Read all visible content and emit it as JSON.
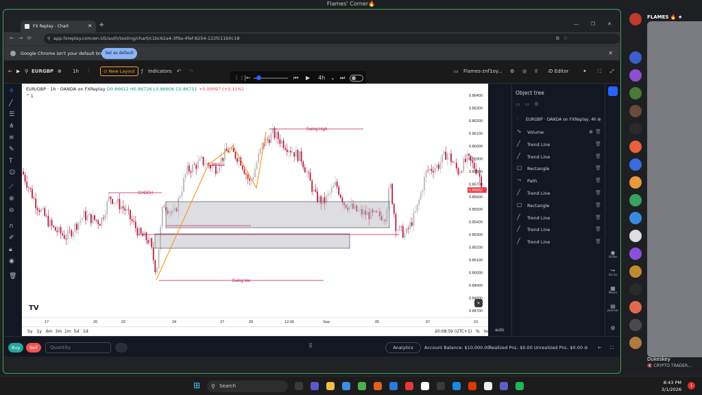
{
  "window_title": "Flames' Corner🔥",
  "chrome": {
    "tab_title": "FX Replay - Chart",
    "url": "app.fxreplay.com/en-US/auth/testing/chart/c1bc62a4-3f9a-4fef-8254-122fc11b0c18",
    "infobar_message": "Google Chrome isn't your default browser",
    "set_default_label": "Set as default"
  },
  "toolbar": {
    "symbol": "EURGBP",
    "timeframe": "1h",
    "new_layout": "New Layout",
    "indicators": "Indicators",
    "replay_timeframe": "4h",
    "layout_name": "Flames-znf1oy...",
    "editor": "Editor"
  },
  "chart": {
    "symbol_line": "EUR/GBP · 1h · OANDA on FXReplay",
    "ohlc": "O0.86612 H0.86726 L0.86606 C0.86711",
    "change": "+0.00097 (+0.11%)",
    "collapse": "^ 1",
    "current_price": "0.85652",
    "y_ticks": [
      "0.86400",
      "0.86300",
      "0.86200",
      "0.86100",
      "0.86000",
      "0.85900",
      "0.85800",
      "0.85700",
      "0.85600",
      "0.85500",
      "0.85400",
      "0.85300",
      "0.85200",
      "0.85100",
      "0.85000",
      "0.84900",
      "0.84800",
      "0.84700"
    ],
    "x_ticks": [
      "17",
      "20",
      "22",
      "24",
      "27",
      "29",
      "12:00",
      "Sep",
      "05",
      "07",
      "10"
    ],
    "annotations": {
      "choch": "CHOCH",
      "swing_high": "Swing High",
      "swing_low": "Swing low",
      "bos": "BOS"
    },
    "logo": "TV"
  },
  "bottom_bar": {
    "ranges": [
      "5y",
      "1y",
      "6m",
      "3m",
      "1m",
      "5d",
      "1d"
    ],
    "time": "20:08:59 (UTC+1)",
    "pct": "%",
    "log": "log",
    "auto": "auto"
  },
  "trade_bar": {
    "buy": "Buy",
    "sell": "Sell",
    "qty_placeholder": "Quantity",
    "analytics": "Analytics",
    "account_balance": "Account Balance: $10,000.00",
    "realized_pnl": "Realized PnL: $0.00",
    "unrealized_pnl": "Unrealized PnL: $0.00"
  },
  "object_tree": {
    "title": "Object tree",
    "source": "EURGBP · OANDA on FXReplay, 4h",
    "items": [
      {
        "label": "Volume",
        "icon": "volume-icon"
      },
      {
        "label": "Trend Line",
        "icon": "trend-line-icon"
      },
      {
        "label": "Trend Line",
        "icon": "trend-line-icon"
      },
      {
        "label": "Rectangle",
        "icon": "rectangle-icon"
      },
      {
        "label": "Path",
        "icon": "path-icon"
      },
      {
        "label": "Trend Line",
        "icon": "trend-line-icon"
      },
      {
        "label": "Rectangle",
        "icon": "rectangle-icon"
      },
      {
        "label": "Trend Line",
        "icon": "trend-line-icon"
      },
      {
        "label": "Trend Line",
        "icon": "trend-line-icon"
      },
      {
        "label": "Trend Line",
        "icon": "trend-line-icon"
      }
    ]
  },
  "right_strip": {
    "order": "Order",
    "goto": "Go to",
    "news": "News",
    "journal": "Journal"
  },
  "discord": {
    "user_top": "FLAMES 🔥 ★",
    "user_bottom": "Dukeskey",
    "user_bottom_status": "🔇 CRYPTO TRADER..."
  },
  "taskbar": {
    "search": "Search",
    "time": "8:43 PM",
    "date": "3/1/2026",
    "notif": "1"
  },
  "colors": {
    "bull": "#089981",
    "bear": "#f23645",
    "annotation": "#c2185b",
    "fib": "#f7931a"
  }
}
